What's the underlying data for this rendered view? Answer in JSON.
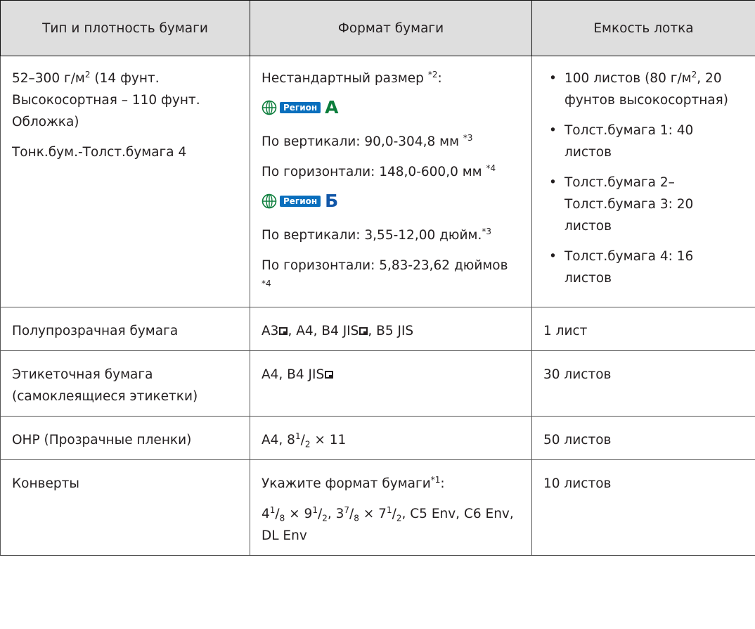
{
  "headers": [
    "Тип и плотность бумаги",
    "Формат бумаги",
    "Емкость лотка"
  ],
  "row1": {
    "type_a_pre": "52–300 г/м",
    "type_a_sup": "2",
    "type_a_post": " (14 фунт. Высокосортная – 110 фунт. Обложка)",
    "type_b": "Тонк.бум.-Толст.бумага 4",
    "size_intro": "Нестандартный размер ",
    "size_intro_sup": "*2",
    "size_intro_colon": ":",
    "region_word": "Регион",
    "region_a": "A",
    "region_b": "Б",
    "a_vertical": "По вертикали: 90,0-304,8 мм ",
    "a_vertical_sup": "*3",
    "a_horizontal": "По горизонтали: 148,0-600,0 мм ",
    "a_horizontal_sup": "*4",
    "b_vertical": "По вертикали: 3,55-12,00 дюйм.",
    "b_vertical_sup": "*3",
    "b_horizontal": "По горизонтали: 5,83-23,62 дюймов ",
    "b_horizontal_sup": "*4",
    "cap1_pre": "100 листов (80 г/м",
    "cap1_sup": "2",
    "cap1_post": ", 20 фунтов высокосортная)",
    "cap2": "Толст.бумага 1: 40 листов",
    "cap3": "Толст.бумага 2–Толст.бумага 3: 20 листов",
    "cap4": "Толст.бумага 4: 16 листов"
  },
  "row2": {
    "type": "Полупрозрачная бумага",
    "size_a3": "A3",
    "size_a4": ", A4, B4 JIS",
    "size_b5": ", B5 JIS",
    "cap": "1 лист"
  },
  "row3": {
    "type": "Этикеточная бумага (самоклеящиеся этикетки)",
    "size": "A4, B4 JIS",
    "cap": "30 листов"
  },
  "row4": {
    "type": "OHP (Прозрачные пленки)",
    "size_pre": "A4, 8",
    "size_sup": "1",
    "size_mid": "/",
    "size_sub": "2",
    "size_post": " × 11",
    "cap": "50 листов"
  },
  "row5": {
    "type": "Конверты",
    "size_intro": "Укажите формат бумаги",
    "size_intro_sup": "*1",
    "size_intro_colon": ":",
    "f1_whole": "4",
    "f1_num": "1",
    "f1_den": "8",
    "f1_mult": " × 9",
    "f1b_num": "1",
    "f1b_den": "2",
    "sep": ", ",
    "f2_whole": "3",
    "f2_num": "7",
    "f2_den": "8",
    "f2_mult": " × 7",
    "f2b_num": "1",
    "f2b_den": "2",
    "rest": ", C5 Env, C6 Env, DL Env",
    "cap": "10 листов"
  },
  "icons": {
    "region_globe": "globe-icon",
    "orientation": "landscape-orientation-icon"
  },
  "colors": {
    "header_bg": "#dedede",
    "region_box": "#0a6fbd",
    "region_a": "#0b7d3b",
    "region_b": "#1257a8"
  }
}
